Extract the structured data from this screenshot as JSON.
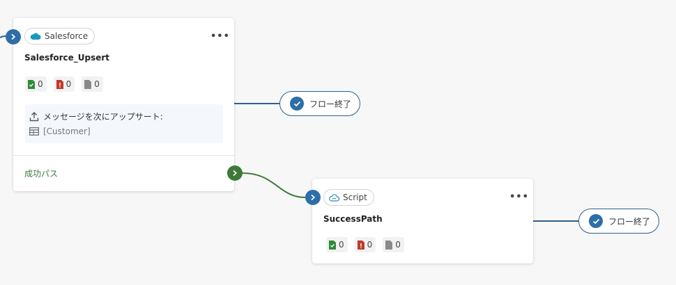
{
  "salesforce_node": {
    "type_label": "Salesforce",
    "more_label": "•••",
    "title": "Salesforce_Upsert",
    "counts": {
      "success": "0",
      "error": "0",
      "skipped": "0"
    },
    "message_label": "メッセージを次にアップサート:",
    "target_table": "[Customer]",
    "success_path_label": "成功パス"
  },
  "script_node": {
    "type_label": "Script",
    "more_label": "•••",
    "title": "SuccessPath",
    "counts": {
      "success": "0",
      "error": "0",
      "skipped": "0"
    }
  },
  "flow_end_1": {
    "label": "フロー終了"
  },
  "flow_end_2": {
    "label": "フロー終了"
  },
  "colors": {
    "accent_blue": "#2e6ea8",
    "success_green": "#3d7a38",
    "error_red": "#c0392b",
    "success_file": "#2f8a3a",
    "skipped_gray": "#8a8a8a",
    "salesforce_blue": "#1798c1"
  }
}
